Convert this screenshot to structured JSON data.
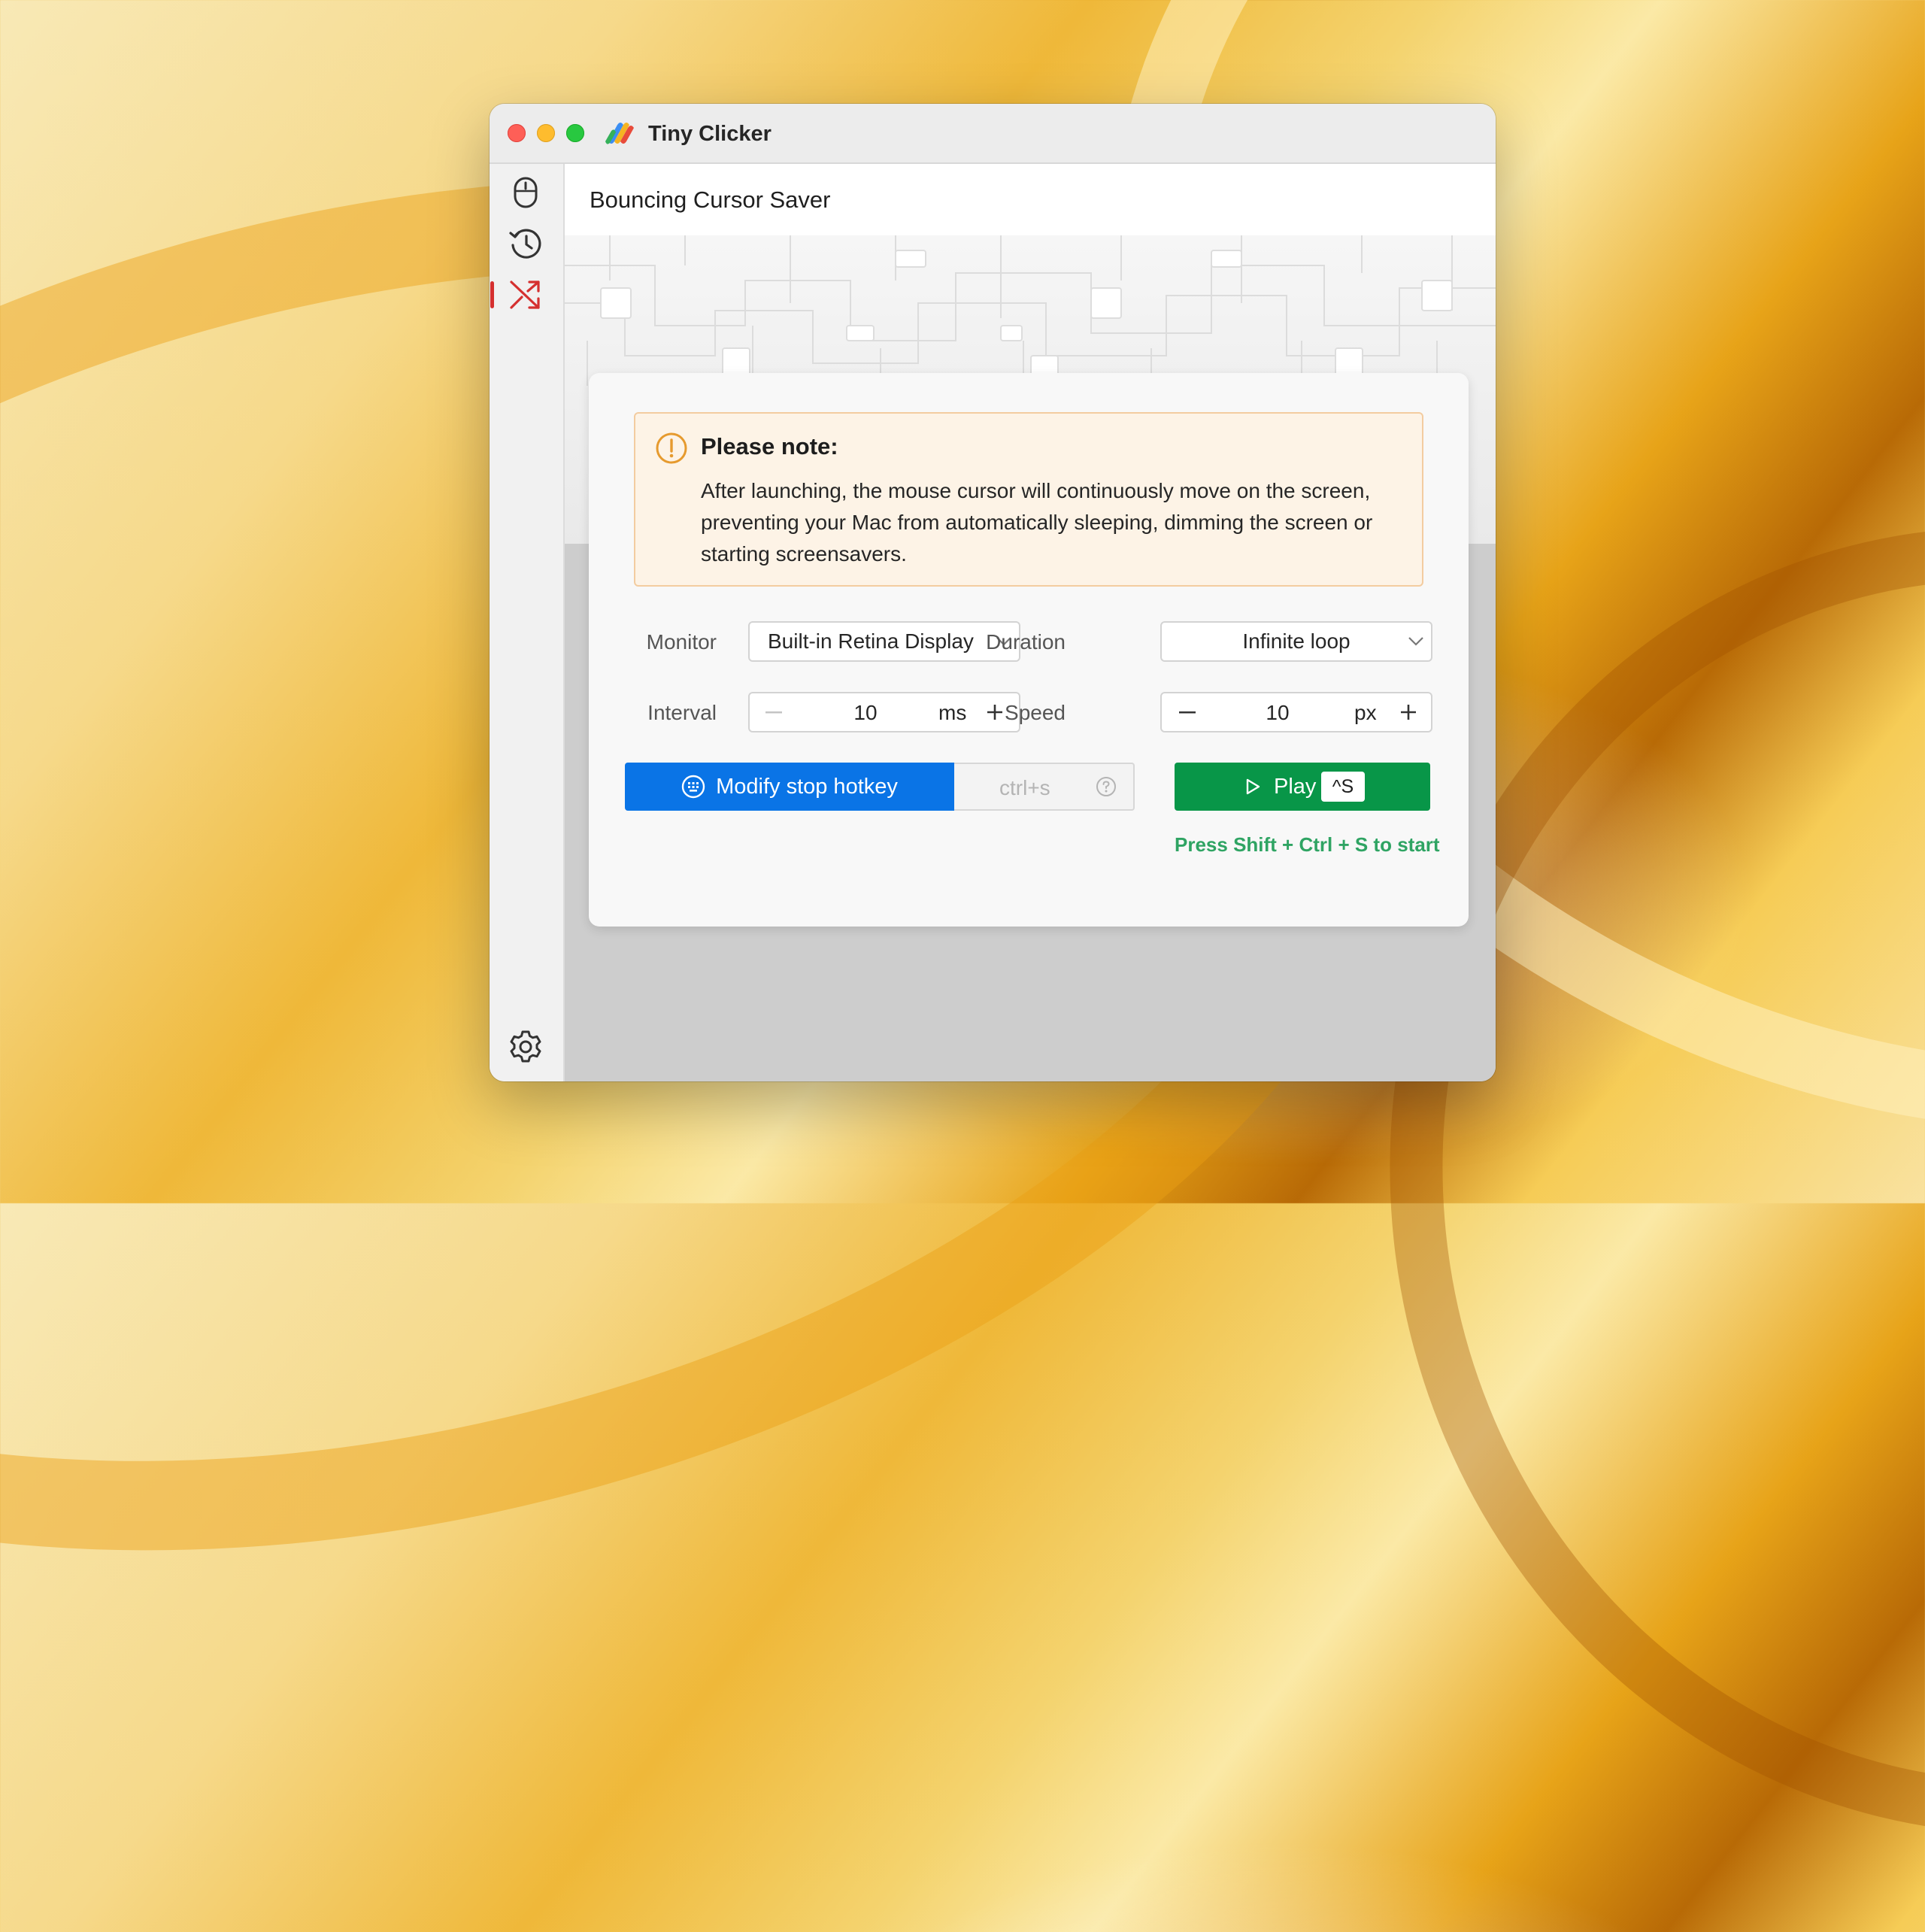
{
  "app": {
    "title": "Tiny Clicker"
  },
  "sidebar": {
    "items": [
      {
        "icon": "mouse-icon",
        "active": false
      },
      {
        "icon": "history-icon",
        "active": false
      },
      {
        "icon": "shuffle-icon",
        "active": true
      }
    ],
    "footer_icon": "gear-icon",
    "active_color": "#d5302f"
  },
  "page": {
    "title": "Bouncing Cursor Saver"
  },
  "note": {
    "title": "Please note:",
    "body": "After launching, the mouse cursor will continuously move on the screen, preventing your Mac from automatically sleeping, dimming the screen or starting screensavers."
  },
  "settings": {
    "monitor": {
      "label": "Monitor",
      "value": "Built-in Retina Display"
    },
    "duration": {
      "label": "Duration",
      "value": "Infinite loop"
    },
    "interval": {
      "label": "Interval",
      "value": "10",
      "unit": "ms"
    },
    "speed": {
      "label": "Speed",
      "value": "10",
      "unit": "px"
    }
  },
  "hotkey": {
    "button_label": "Modify stop hotkey",
    "current": "ctrl+s"
  },
  "play": {
    "label": "Play",
    "shortcut": "^S"
  },
  "hint": "Press Shift + Ctrl + S to start",
  "colors": {
    "primary_blue": "#0a74e6",
    "play_green": "#089648",
    "hint_green": "#2fa463",
    "note_bg": "#fdf3e6",
    "warning_orange": "#e69a2e"
  }
}
